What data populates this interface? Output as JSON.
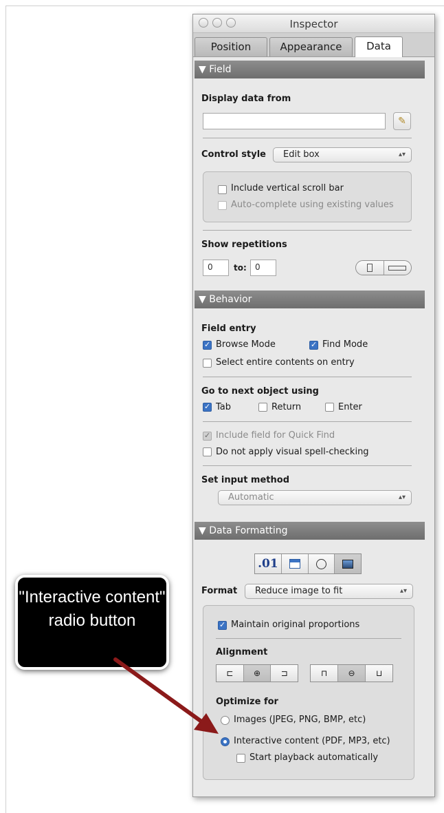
{
  "window": {
    "title": "Inspector"
  },
  "tabs": [
    {
      "label": "Position"
    },
    {
      "label": "Appearance"
    },
    {
      "label": "Data",
      "active": true
    }
  ],
  "field_section": {
    "header": "▼ Field",
    "display_data_from_label": "Display data from",
    "display_data_from_value": "",
    "control_style_label": "Control style",
    "control_style_value": "Edit box",
    "include_scroll_bar": "Include vertical scroll bar",
    "auto_complete": "Auto-complete using existing values",
    "show_repetitions_label": "Show repetitions",
    "repetitions_from": "0",
    "repetitions_to_label": "to:",
    "repetitions_to": "0"
  },
  "behavior_section": {
    "header": "▼ Behavior",
    "field_entry_label": "Field entry",
    "browse_mode": "Browse Mode",
    "find_mode": "Find Mode",
    "select_entire": "Select entire contents on entry",
    "go_next_label": "Go to next object using",
    "tab": "Tab",
    "return": "Return",
    "enter": "Enter",
    "include_quick_find": "Include field for Quick Find",
    "no_spell_check": "Do not apply visual spell-checking",
    "set_input_method_label": "Set input method",
    "input_method_value": "Automatic"
  },
  "data_formatting_section": {
    "header": "▼ Data Formatting",
    "format_number_glyph": ".01",
    "format_label": "Format",
    "format_value": "Reduce image to fit",
    "maintain_proportions": "Maintain original proportions",
    "alignment_label": "Alignment",
    "optimize_for_label": "Optimize for",
    "images_option": "Images (JPEG, PNG, BMP, etc)",
    "interactive_option": "Interactive content (PDF, MP3, etc)",
    "start_playback": "Start playback automatically"
  },
  "callout": {
    "text": "\"Interactive content\" radio button"
  },
  "colors": {
    "section_header": "#7a7a7a",
    "checkbox_blue": "#3b73c4",
    "arrow_red": "#8b1a1a"
  }
}
